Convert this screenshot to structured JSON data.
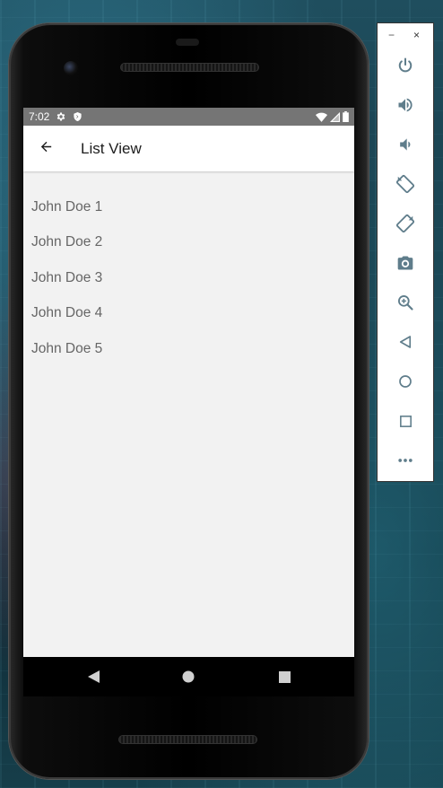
{
  "status_bar": {
    "time": "7:02",
    "icons": [
      "gear-icon",
      "shield-icon",
      "wifi-icon",
      "signal-icon",
      "battery-icon"
    ]
  },
  "app_bar": {
    "back_icon": "arrow-back-icon",
    "title": "List View"
  },
  "list": {
    "items": [
      "John Doe 1",
      "John Doe 2",
      "John Doe 3",
      "John Doe 4",
      "John Doe 5"
    ]
  },
  "nav_bar": {
    "buttons": [
      "back-triangle-icon",
      "home-circle-icon",
      "recents-square-icon"
    ]
  },
  "emulator_panel": {
    "minimize": "−",
    "close": "×",
    "controls": [
      "power-icon",
      "volume-up-icon",
      "volume-down-icon",
      "rotate-left-icon",
      "rotate-right-icon",
      "camera-icon",
      "zoom-icon",
      "back-icon",
      "home-icon",
      "overview-icon",
      "more-icon"
    ]
  },
  "colors": {
    "status_bar": "#757575",
    "app_bar": "#ffffff",
    "screen_bg": "#f2f2f2",
    "list_text": "#666666",
    "emulator_icon": "#5f7d8b"
  }
}
